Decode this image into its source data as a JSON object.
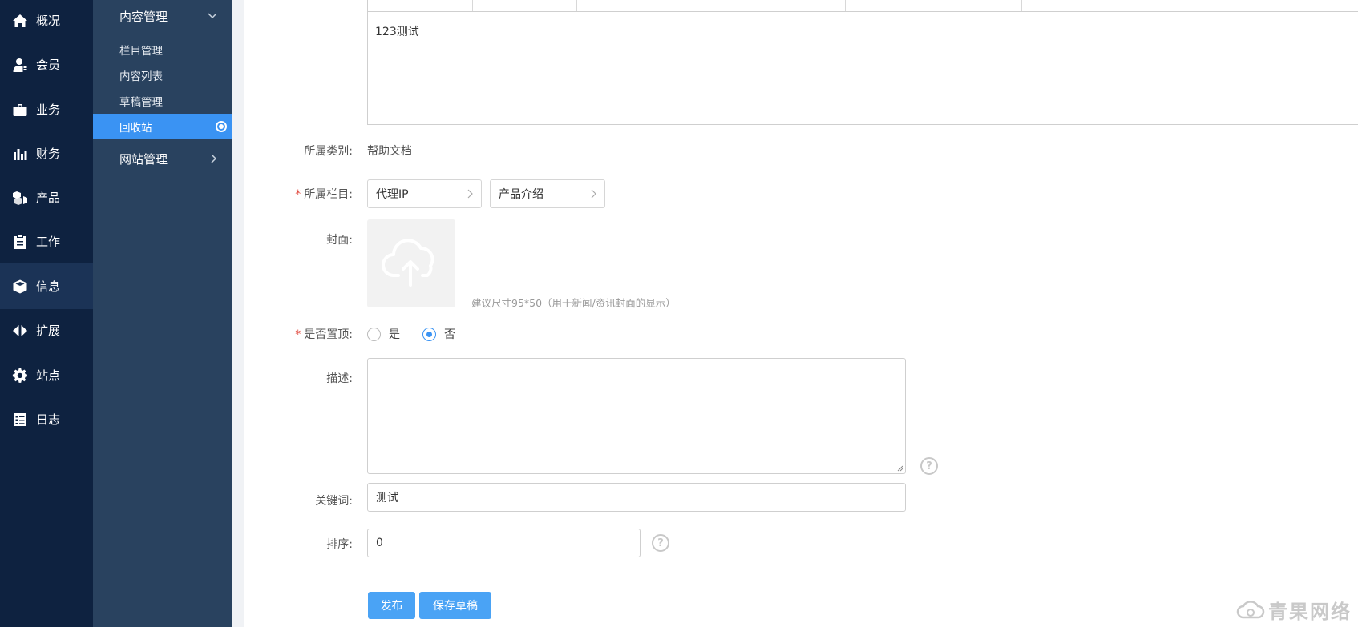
{
  "primary_nav": {
    "items": [
      {
        "label": "概况",
        "icon": "home-icon"
      },
      {
        "label": "会员",
        "icon": "user-icon"
      },
      {
        "label": "业务",
        "icon": "briefcase-icon"
      },
      {
        "label": "财务",
        "icon": "bar-chart-icon"
      },
      {
        "label": "产品",
        "icon": "cubes-icon"
      },
      {
        "label": "工作",
        "icon": "clipboard-icon"
      },
      {
        "label": "信息",
        "icon": "cube-icon",
        "active": true
      },
      {
        "label": "扩展",
        "icon": "arrows-horizontal-icon"
      },
      {
        "label": "站点",
        "icon": "gear-icon"
      },
      {
        "label": "日志",
        "icon": "log-list-icon"
      }
    ]
  },
  "secondary_nav": {
    "group_content": "内容管理",
    "items": [
      "栏目管理",
      "内容列表",
      "草稿管理",
      "回收站"
    ],
    "active_item": "回收站",
    "group_site": "网站管理"
  },
  "form": {
    "editor_content": "123测试",
    "category_label": "所属类别:",
    "category_value": "帮助文档",
    "column_label": "所属栏目:",
    "column_select_1": "代理IP",
    "column_select_2": "产品介绍",
    "cover_label": "封面:",
    "cover_hint": "建议尺寸95*50（用于新闻/资讯封面的显示）",
    "pin_label": "是否置顶:",
    "pin_yes": "是",
    "pin_no": "否",
    "pin_selected": "否",
    "desc_label": "描述:",
    "desc_value": "",
    "keywords_label": "关键词:",
    "keywords_value": "测试",
    "sort_label": "排序:",
    "sort_value": "0",
    "required_mark": "*",
    "help_glyph": "?",
    "publish_button": "发布",
    "save_draft_button": "保存草稿"
  },
  "watermark": "青果网络",
  "colors": {
    "primary_nav_bg": "#0e2240",
    "secondary_nav_bg": "#29425f",
    "accent": "#3a93f3",
    "button": "#4aa3f5",
    "required": "#e0453a"
  }
}
